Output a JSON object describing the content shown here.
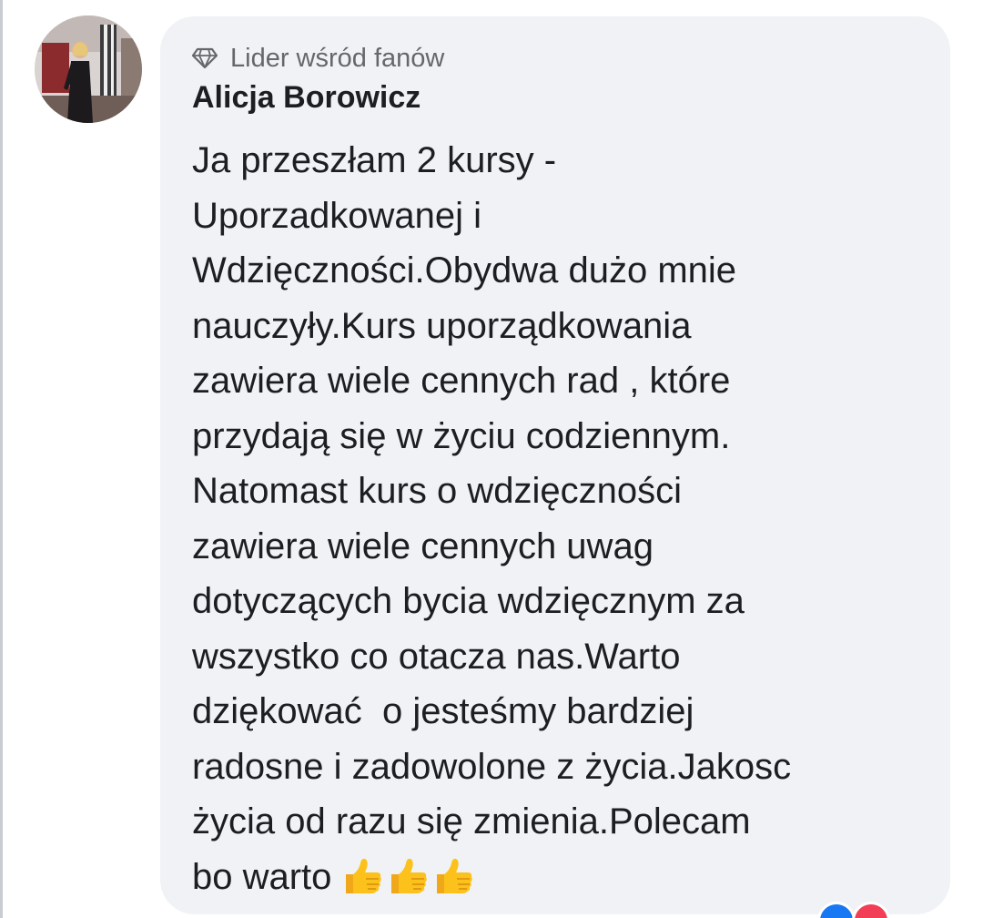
{
  "comment": {
    "badge_label": "Lider wśród fanów",
    "badge_icon": "diamond-icon",
    "author_name": "Alicja Borowicz",
    "lines": [
      "Ja przeszłam 2 kursy -",
      "Uporzadkowanej i",
      "Wdzięczności.Obydwa dużo mnie",
      "nauczyły.Kurs uporządkowania",
      "zawiera wiele cennych rad , które",
      "przydają się w życiu codziennym.",
      "Natomast kurs o wdzięczności",
      "zawiera wiele cennych uwag",
      "dotyczących bycia wdzięcznym za",
      "wszystko co otacza nas.Warto",
      "dziękować  o jesteśmy bardziej",
      "radosne i zadowolone z życia.Jakosc",
      "życia od razu się zmienia.Polecam",
      "bo warto"
    ],
    "emoji": [
      "thumbs-up-icon",
      "thumbs-up-icon",
      "thumbs-up-icon"
    ]
  },
  "reactions": [
    "like-icon",
    "love-icon"
  ],
  "colors": {
    "bubble_bg": "#f0f2f5",
    "text": "#1c1e21",
    "secondary_text": "#65676b",
    "like": "#1877f2",
    "love": "#f33e58",
    "thumb": "#fcc21b"
  }
}
